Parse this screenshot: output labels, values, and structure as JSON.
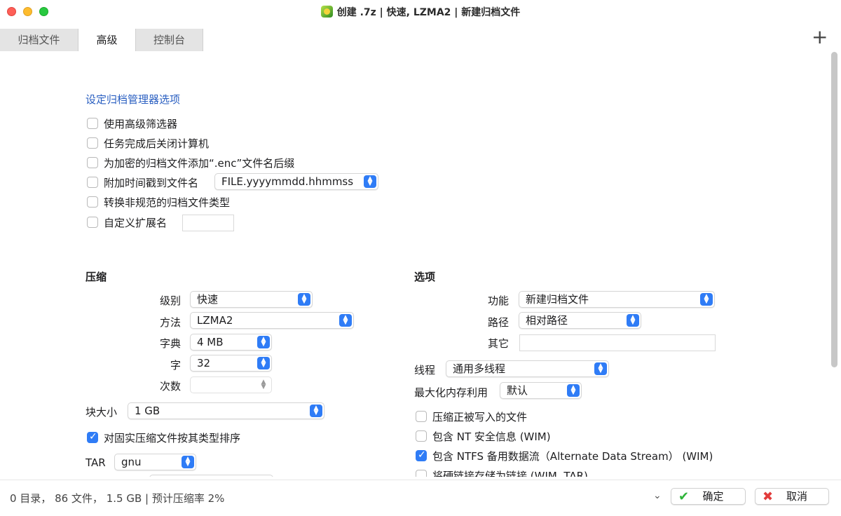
{
  "window": {
    "title": "创建 .7z | 快速, LZMA2 | 新建归档文件",
    "app_icon": "7zip-green-icon"
  },
  "tabs": [
    {
      "label": "归档文件",
      "active": false
    },
    {
      "label": "高级",
      "active": true
    },
    {
      "label": "控制台",
      "active": false
    }
  ],
  "add_label": "+",
  "archiver_options": {
    "heading": "设定归档管理器选项",
    "use_advanced_filter": {
      "label": "使用高级筛选器",
      "checked": false
    },
    "shutdown_after": {
      "label": "任务完成后关闭计算机",
      "checked": false
    },
    "add_enc_ext": {
      "label": "为加密的归档文件添加“.enc”文件名后缀",
      "checked": false
    },
    "append_timestamp": {
      "label": "附加时间戳到文件名",
      "checked": false,
      "format": "FILE.yyyymmdd.hhmmss"
    },
    "convert_nonstandard": {
      "label": "转换非规范的归档文件类型",
      "checked": false
    },
    "custom_ext": {
      "label": "自定义扩展名",
      "checked": false,
      "value": ""
    }
  },
  "compression": {
    "heading": "压缩",
    "level": {
      "label": "级别",
      "value": "快速"
    },
    "method": {
      "label": "方法",
      "value": "LZMA2"
    },
    "dictionary": {
      "label": "字典",
      "value": "4 MB"
    },
    "word": {
      "label": "字",
      "value": "32"
    },
    "passes": {
      "label": "次数",
      "value": ""
    },
    "block_size": {
      "label": "块大小",
      "value": "1 GB"
    },
    "sort_solid": {
      "label": "对固实压缩文件按其类型排序",
      "checked": true
    },
    "tar": {
      "label": "TAR",
      "value": "gnu"
    }
  },
  "options": {
    "heading": "选项",
    "function": {
      "label": "功能",
      "value": "新建归档文件"
    },
    "path": {
      "label": "路径",
      "value": "相对路径"
    },
    "other": {
      "label": "其它",
      "value": ""
    },
    "threads": {
      "label": "线程",
      "value": "通用多线程"
    },
    "max_memory": {
      "label": "最大化内存利用",
      "value": "默认"
    },
    "compress_open": {
      "label": "压缩正被写入的文件",
      "checked": false
    },
    "nt_security": {
      "label": "包含 NT 安全信息 (WIM)",
      "checked": false
    },
    "ntfs_ads": {
      "label": "包含 NTFS 备用数据流（Alternate Data Stream） (WIM)",
      "checked": true
    },
    "hardlinks": {
      "label": "将硬链接存储为链接 (WIM, TAR)",
      "checked": false
    }
  },
  "footer": {
    "status": "0 目录， 86 文件， 1.5 GB | 预计压缩率 2%",
    "ok_label": "确定",
    "cancel_label": "取消",
    "more_icon": "chevron-down-icon"
  },
  "colors": {
    "accent": "#2f7cf6",
    "link": "#2a5fc1",
    "ok": "#2fb43a",
    "cancel": "#e23b3b"
  }
}
